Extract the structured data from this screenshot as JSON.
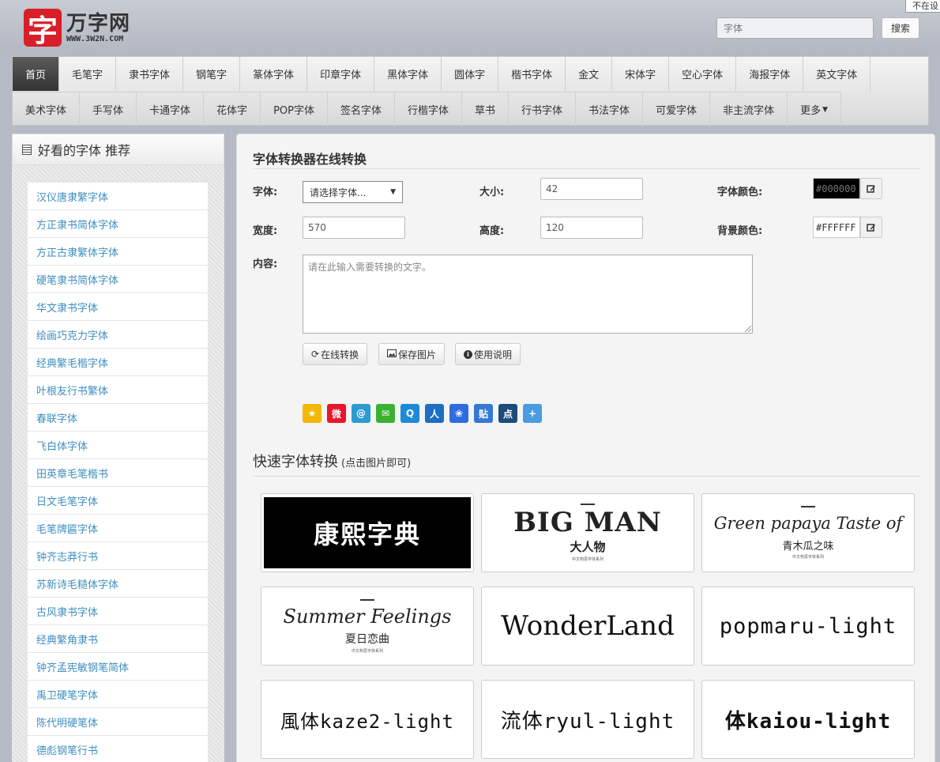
{
  "header": {
    "logo_mark": "字",
    "logo_name": "万字网",
    "logo_url": "WWW.3W2N.COM",
    "search_placeholder": "字体",
    "search_button": "搜索",
    "corner_tip": "不在设"
  },
  "nav": {
    "row1": [
      "首页",
      "毛笔字",
      "隶书字体",
      "钢笔字",
      "篆体字体",
      "印章字体",
      "黑体字体",
      "圆体字",
      "楷书字体",
      "金文",
      "宋体字",
      "空心字体",
      "海报字体",
      "英文字体"
    ],
    "row2": [
      "美术字体",
      "手写体",
      "卡通字体",
      "花体字",
      "POP字体",
      "签名字体",
      "行楷字体",
      "草书",
      "行书字体",
      "书法字体",
      "可爱字体",
      "非主流字体"
    ],
    "more": "更多",
    "active": "首页"
  },
  "sidebar": {
    "title": "好看的字体 推荐",
    "items": [
      "汉仪唐隶繁字体",
      "方正隶书简体字体",
      "方正古隶繁体字体",
      "硬笔隶书简体字体",
      "华文隶书字体",
      "绘画巧克力字体",
      "经典繁毛楷字体",
      "叶根友行书繁体",
      "春联字体",
      "飞白体字体",
      "田英章毛笔楷书",
      "日文毛笔字体",
      "毛笔牌匾字体",
      "钟齐志莽行书",
      "苏新诗毛糙体字体",
      "古风隶书字体",
      "经典繁角隶书",
      "钟齐孟宪敏钢笔简体",
      "禹卫硬笔字体",
      "陈代明硬笔体",
      "德彪钢笔行书"
    ]
  },
  "converter": {
    "title": "字体转换器在线转换",
    "font_label": "字体:",
    "font_select": "请选择字体...",
    "size_label": "大小:",
    "size_value": "42",
    "font_color_label": "字体颜色:",
    "font_color_value": "#000000",
    "width_label": "宽度:",
    "width_value": "570",
    "height_label": "高度:",
    "height_value": "120",
    "bg_color_label": "背景颜色:",
    "bg_color_value": "#FFFFFF",
    "content_label": "内容:",
    "content_placeholder": "请在此输入需要转换的文字。",
    "btn_convert": "在线转换",
    "btn_save": "保存图片",
    "btn_help": "使用说明"
  },
  "share_icons": [
    {
      "name": "qzone-icon",
      "glyph": "★",
      "color": "#f2b807"
    },
    {
      "name": "weibo-icon",
      "glyph": "微",
      "color": "#e6162d"
    },
    {
      "name": "tencent-weibo-icon",
      "glyph": "@",
      "color": "#2c9bd1"
    },
    {
      "name": "wechat-icon",
      "glyph": "✉",
      "color": "#3bb132"
    },
    {
      "name": "qq-icon",
      "glyph": "Q",
      "color": "#1c8ad8"
    },
    {
      "name": "renren-icon",
      "glyph": "人",
      "color": "#1d6fc1"
    },
    {
      "name": "baidu-icon",
      "glyph": "❀",
      "color": "#2f6ce0"
    },
    {
      "name": "tieba-icon",
      "glyph": "贴",
      "color": "#3579d3"
    },
    {
      "name": "dianping-icon",
      "glyph": "点",
      "color": "#1e4c7a"
    },
    {
      "name": "more-share-icon",
      "glyph": "+",
      "color": "#4a9be0"
    }
  ],
  "quick": {
    "title": "快速字体转换",
    "subtitle": "(点击图片即可)",
    "tiles": [
      {
        "main": "康熙字典"
      },
      {
        "main": "BIG MAN",
        "cn": "大人物",
        "cn_small": "中文构思字体系列"
      },
      {
        "main": "Green papaya Taste of",
        "cn": "青木瓜之味",
        "cn_small": "中文构思字体系列"
      },
      {
        "main": "Summer Feelings",
        "cn": "夏日恋曲",
        "cn_small": "中文构思字体系列"
      },
      {
        "main": "WonderLand"
      },
      {
        "main": "popmaru-light"
      },
      {
        "main": "風体kaze2-light"
      },
      {
        "main": "流体ryul-light"
      },
      {
        "main": "体kaiou-light"
      }
    ]
  }
}
